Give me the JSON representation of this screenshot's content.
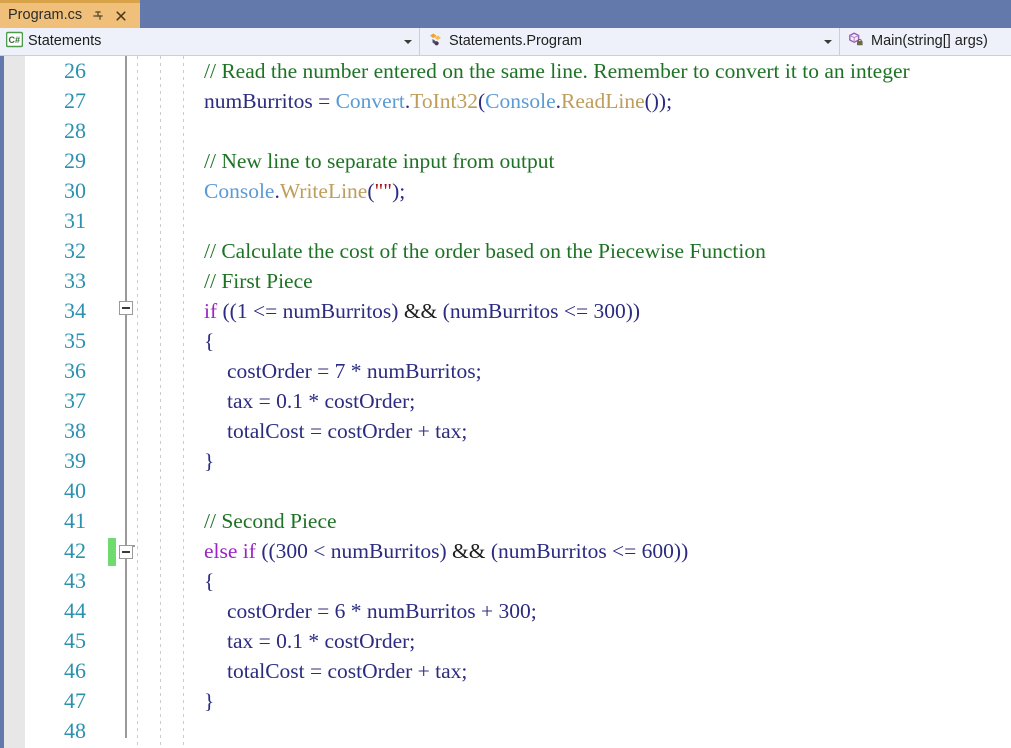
{
  "window": {
    "accent_blue": "#6379ab",
    "tab_bg": "#f0c07a",
    "navbar_bg": "#eef1f9"
  },
  "tabs": [
    {
      "label": "Program.cs",
      "active": true,
      "pin_icon": "pin-icon",
      "close_icon": "close-icon"
    }
  ],
  "navbar": {
    "project": {
      "icon": "csharp-file-icon",
      "label": "Statements",
      "caret_icon": "chevron-down-icon"
    },
    "type": {
      "icon": "class-icon",
      "label": "Statements.Program",
      "caret_icon": "chevron-down-icon"
    },
    "member": {
      "icon": "method-private-icon",
      "label": "Main(string[] args)"
    }
  },
  "editor": {
    "first_line": 26,
    "last_line": 48,
    "line_number_color": "#2b91af",
    "gutter_bg": "#e7e7e7",
    "change_bar_color": "#6fdb6f",
    "syntax_colors": {
      "comment": "#1d7324",
      "keyword": "#9b24c4",
      "type": "#5b9bd5",
      "method": "#bf9d5a",
      "string": "#a31515",
      "identifier": "#2b2b80",
      "operator": "#1f1f1f"
    },
    "lines": [
      {
        "n": "26",
        "tokens": [
          {
            "t": "comment",
            "s": "// Read the number entered on the same line. Remember to convert it to an integer"
          }
        ]
      },
      {
        "n": "27",
        "tokens": [
          {
            "t": "plain",
            "s": "numBurritos = "
          },
          {
            "t": "type",
            "s": "Convert"
          },
          {
            "t": "punct",
            "s": "."
          },
          {
            "t": "method",
            "s": "ToInt32"
          },
          {
            "t": "punct",
            "s": "("
          },
          {
            "t": "type",
            "s": "Console"
          },
          {
            "t": "punct",
            "s": "."
          },
          {
            "t": "method",
            "s": "ReadLine"
          },
          {
            "t": "punct",
            "s": "());"
          }
        ]
      },
      {
        "n": "28",
        "tokens": []
      },
      {
        "n": "29",
        "tokens": [
          {
            "t": "comment",
            "s": "// New line to separate input from output"
          }
        ]
      },
      {
        "n": "30",
        "tokens": [
          {
            "t": "type",
            "s": "Console"
          },
          {
            "t": "punct",
            "s": "."
          },
          {
            "t": "method",
            "s": "WriteLine"
          },
          {
            "t": "punct",
            "s": "("
          },
          {
            "t": "string",
            "s": "\"\""
          },
          {
            "t": "punct",
            "s": ");"
          }
        ]
      },
      {
        "n": "31",
        "tokens": []
      },
      {
        "n": "32",
        "tokens": [
          {
            "t": "comment",
            "s": "// Calculate the cost of the order based on the Piecewise Function"
          }
        ]
      },
      {
        "n": "33",
        "tokens": [
          {
            "t": "comment",
            "s": "// First Piece"
          }
        ]
      },
      {
        "n": "34",
        "tokens": [
          {
            "t": "keyword",
            "s": "if"
          },
          {
            "t": "plain",
            "s": " ((1 <= numBurritos) "
          },
          {
            "t": "op",
            "s": "&&"
          },
          {
            "t": "plain",
            "s": " (numBurritos <= 300))"
          }
        ]
      },
      {
        "n": "35",
        "tokens": [
          {
            "t": "plain",
            "s": "{"
          }
        ]
      },
      {
        "n": "36",
        "indent": 1,
        "tokens": [
          {
            "t": "plain",
            "s": "costOrder = 7 * numBurritos;"
          }
        ]
      },
      {
        "n": "37",
        "indent": 1,
        "tokens": [
          {
            "t": "plain",
            "s": "tax = 0.1 * costOrder;"
          }
        ]
      },
      {
        "n": "38",
        "indent": 1,
        "tokens": [
          {
            "t": "plain",
            "s": "totalCost = costOrder + tax;"
          }
        ]
      },
      {
        "n": "39",
        "tokens": [
          {
            "t": "plain",
            "s": "}"
          }
        ]
      },
      {
        "n": "40",
        "tokens": []
      },
      {
        "n": "41",
        "tokens": [
          {
            "t": "comment",
            "s": "// Second Piece"
          }
        ]
      },
      {
        "n": "42",
        "tokens": [
          {
            "t": "keyword",
            "s": "else if"
          },
          {
            "t": "plain",
            "s": " ((300 < numBurritos) "
          },
          {
            "t": "op",
            "s": "&&"
          },
          {
            "t": "plain",
            "s": " (numBurritos <= 600))"
          }
        ]
      },
      {
        "n": "43",
        "tokens": [
          {
            "t": "plain",
            "s": "{"
          }
        ]
      },
      {
        "n": "44",
        "indent": 1,
        "tokens": [
          {
            "t": "plain",
            "s": "costOrder = 6 * numBurritos + 300;"
          }
        ]
      },
      {
        "n": "45",
        "indent": 1,
        "tokens": [
          {
            "t": "plain",
            "s": "tax = 0.1 * costOrder;"
          }
        ]
      },
      {
        "n": "46",
        "indent": 1,
        "tokens": [
          {
            "t": "plain",
            "s": "totalCost = costOrder + tax;"
          }
        ]
      },
      {
        "n": "47",
        "tokens": [
          {
            "t": "plain",
            "s": "}"
          }
        ]
      },
      {
        "n": "48",
        "tokens": []
      }
    ],
    "fold_regions": [
      {
        "type": "box",
        "line_index": 8
      },
      {
        "type": "box",
        "line_index": 16
      },
      {
        "type": "tick",
        "line_index": 15
      }
    ]
  }
}
